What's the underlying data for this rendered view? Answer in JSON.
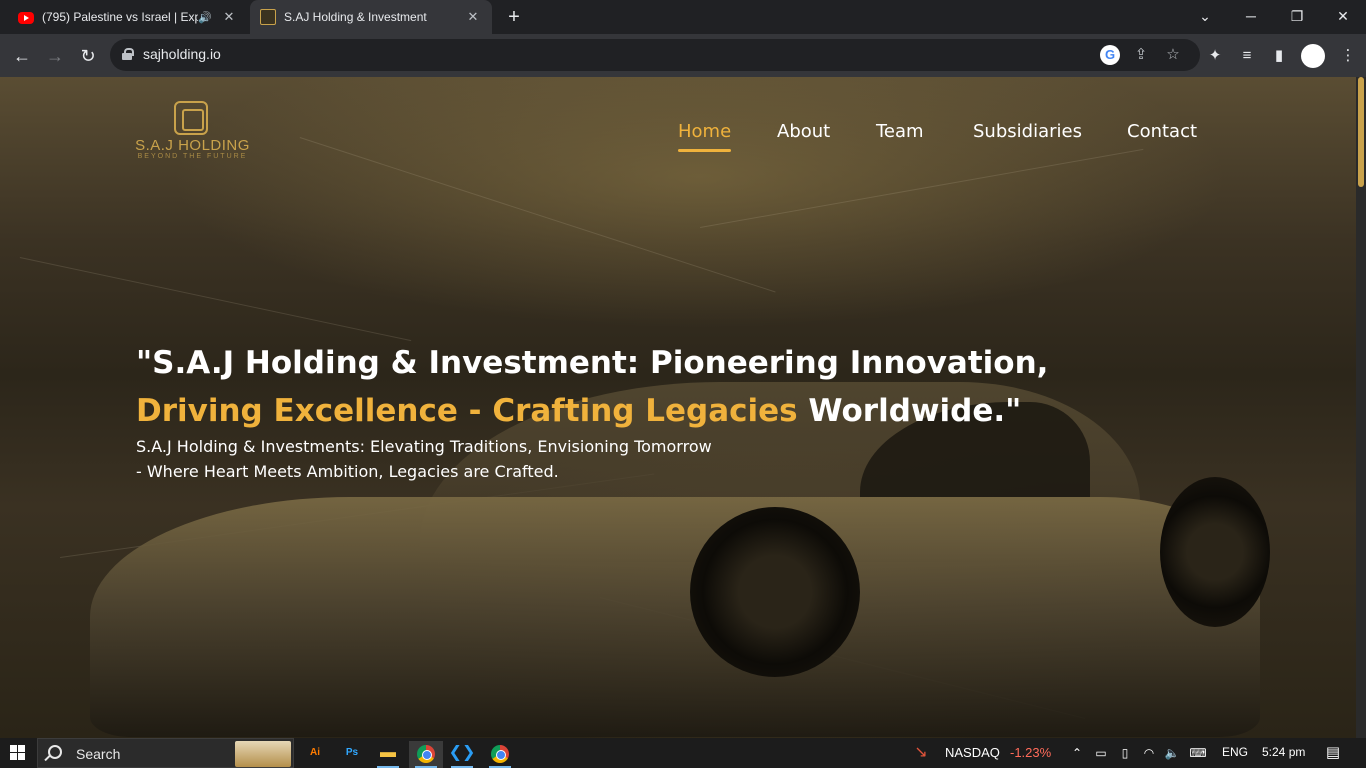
{
  "browser": {
    "tabs": [
      {
        "title": "(795) Palestine vs Israel | Exp",
        "favicon": "youtube-icon",
        "audio": "🔊",
        "active": false
      },
      {
        "title": "S.AJ Holding & Investment",
        "favicon": "saj-logo-icon",
        "active": true
      }
    ],
    "url": "sajholding.io",
    "window_controls": {
      "dropdown": "⌄",
      "minimize": "─",
      "restore": "❐",
      "close": "✕"
    }
  },
  "site": {
    "logo_name": "S.A.J HOLDING",
    "logo_tagline": "BEYOND THE FUTURE",
    "nav": [
      {
        "label": "Home",
        "active": true
      },
      {
        "label": "About",
        "active": false
      },
      {
        "label": "Team",
        "active": false
      },
      {
        "label": "Subsidiaries",
        "active": false
      },
      {
        "label": "Contact",
        "active": false
      }
    ],
    "hero": {
      "line1": "\"S.A.J Holding & Investment: Pioneering Innovation,",
      "line2_gold_a": "Driving Excellence",
      "line2_sep": " - ",
      "line2_gold_b": "Crafting Legacies",
      "line2_rest": " Worldwide.\"",
      "sub1": "S.A.J Holding & Investments: Elevating Traditions, Envisioning Tomorrow",
      "sub2": "- Where Heart Meets Ambition, Legacies are Crafted."
    },
    "colors": {
      "accent": "#f0b23c",
      "logo_gold": "#c9a24b"
    }
  },
  "taskbar": {
    "search_placeholder": "Search",
    "apps": [
      {
        "name": "Ai",
        "icon": "illustrator-icon"
      },
      {
        "name": "Ps",
        "icon": "photoshop-icon"
      },
      {
        "name": "",
        "icon": "file-explorer-icon"
      },
      {
        "name": "",
        "icon": "chrome-icon"
      },
      {
        "name": "",
        "icon": "vscode-icon"
      },
      {
        "name": "",
        "icon": "chrome-icon"
      }
    ],
    "ticker_name": "NASDAQ",
    "ticker_change": "-1.23%",
    "language": "ENG",
    "time": "5:24 pm"
  }
}
